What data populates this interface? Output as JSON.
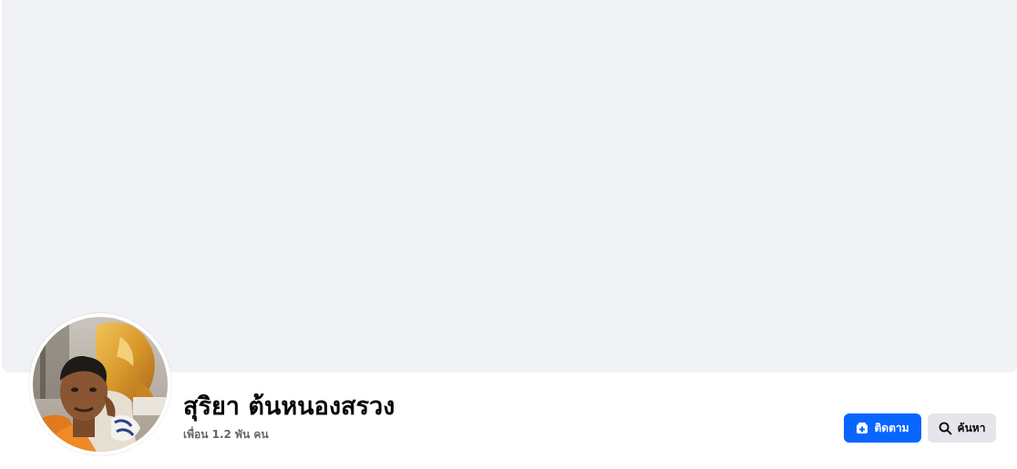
{
  "profile": {
    "name": "สุริยา ต้นหนองสรวง",
    "friends": "เพื่อน 1.2 พัน คน"
  },
  "actions": {
    "follow_label": "ติดตาม",
    "follow_icon": "follow-icon",
    "search_label": "ค้นหา",
    "search_icon": "search-icon"
  },
  "colors": {
    "cover": "#f0f2f5",
    "primary": "#0866ff",
    "secondary": "#e4e6eb",
    "name_text": "#050505",
    "muted_text": "#65676b"
  }
}
